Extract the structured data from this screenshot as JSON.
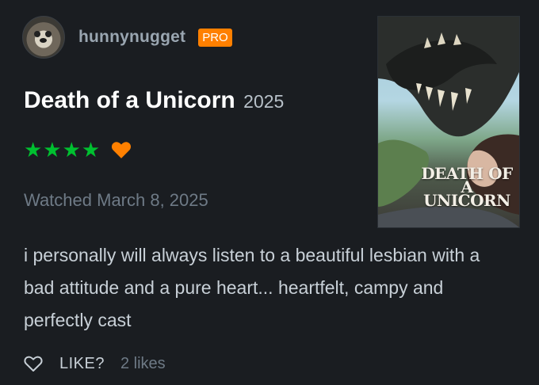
{
  "user": {
    "username": "hunnynugget",
    "badge": "PRO"
  },
  "film": {
    "title": "Death of a Unicorn",
    "year": "2025",
    "poster_title": "DEATH OF A UNICORN"
  },
  "rating": {
    "stars": 4,
    "stars_text": "★★★★",
    "liked": true
  },
  "watched_text": "Watched March 8, 2025",
  "review_text": "i personally will always listen to a beautiful lesbian with a bad attitude and a pure heart... heartfelt, campy and perfectly cast",
  "footer": {
    "like_label": "LIKE?",
    "likes_count": "2 likes"
  },
  "colors": {
    "background": "#1a1d21",
    "star": "#00c030",
    "heart": "#ff8000",
    "badge": "#ff8000"
  },
  "icons": {
    "avatar": "avatar-image",
    "heart": "heart-icon",
    "like": "heart-outline-icon"
  }
}
